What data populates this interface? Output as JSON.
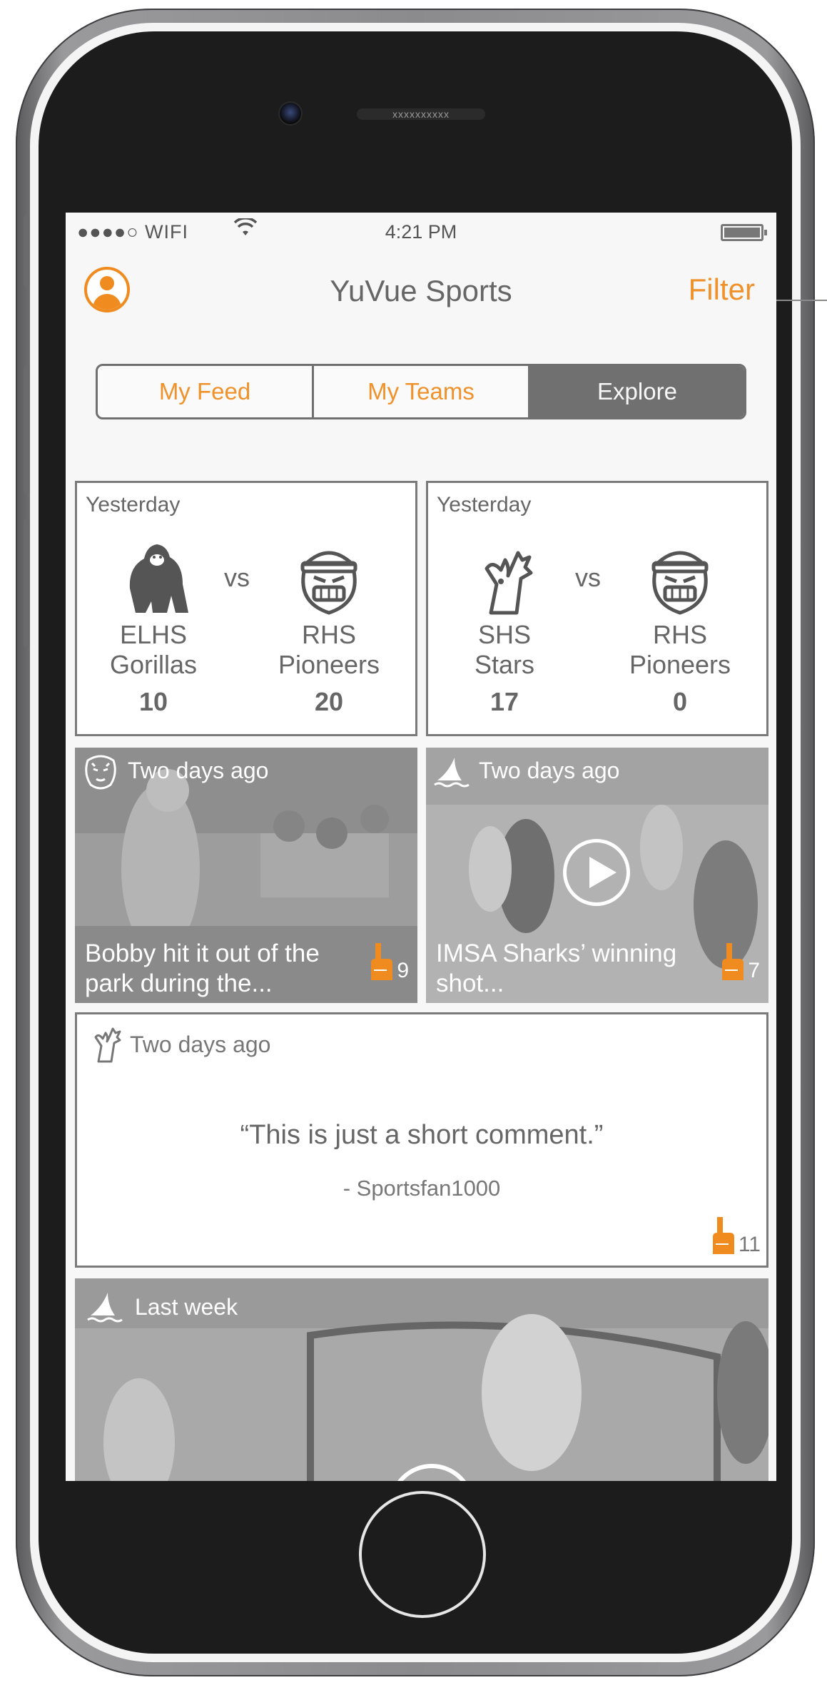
{
  "status_bar": {
    "carrier": "●●●●○ WIFI",
    "time": "4:21 PM"
  },
  "nav": {
    "title": "YuVue Sports",
    "filter_label": "Filter"
  },
  "tabs": [
    {
      "label": "My Feed",
      "active": false
    },
    {
      "label": "My Teams",
      "active": false
    },
    {
      "label": "Explore",
      "active": true
    }
  ],
  "score_cards": [
    {
      "when": "Yesterday",
      "vs": "vs",
      "home": {
        "name": "ELHS\nGorillas",
        "score": "10",
        "logo": "gorilla-icon"
      },
      "away": {
        "name": "RHS\nPioneers",
        "score": "20",
        "logo": "pioneer-icon"
      }
    },
    {
      "when": "Yesterday",
      "vs": "vs",
      "home": {
        "name": "SHS\nStars",
        "score": "17",
        "logo": "star-mascot-icon"
      },
      "away": {
        "name": "RHS\nPioneers",
        "score": "0",
        "logo": "pioneer-icon"
      }
    }
  ],
  "photo_posts": [
    {
      "when": "Two days ago",
      "caption": "Bobby hit it out of the park during the...",
      "likes": "9",
      "team_icon": "tiger-icon"
    },
    {
      "when": "Two days ago",
      "caption": "IMSA Sharks’ winning shot...",
      "likes": "7",
      "team_icon": "shark-icon"
    }
  ],
  "comment_post": {
    "when": "Two days ago",
    "quote": "“This is just a short comment.”",
    "author": "- Sportsfan1000",
    "likes": "11",
    "team_icon": "star-mascot-icon"
  },
  "video_post": {
    "when": "Last week",
    "team_icon": "shark-icon"
  },
  "colors": {
    "accent": "#f0922b",
    "gray": "#707070"
  }
}
